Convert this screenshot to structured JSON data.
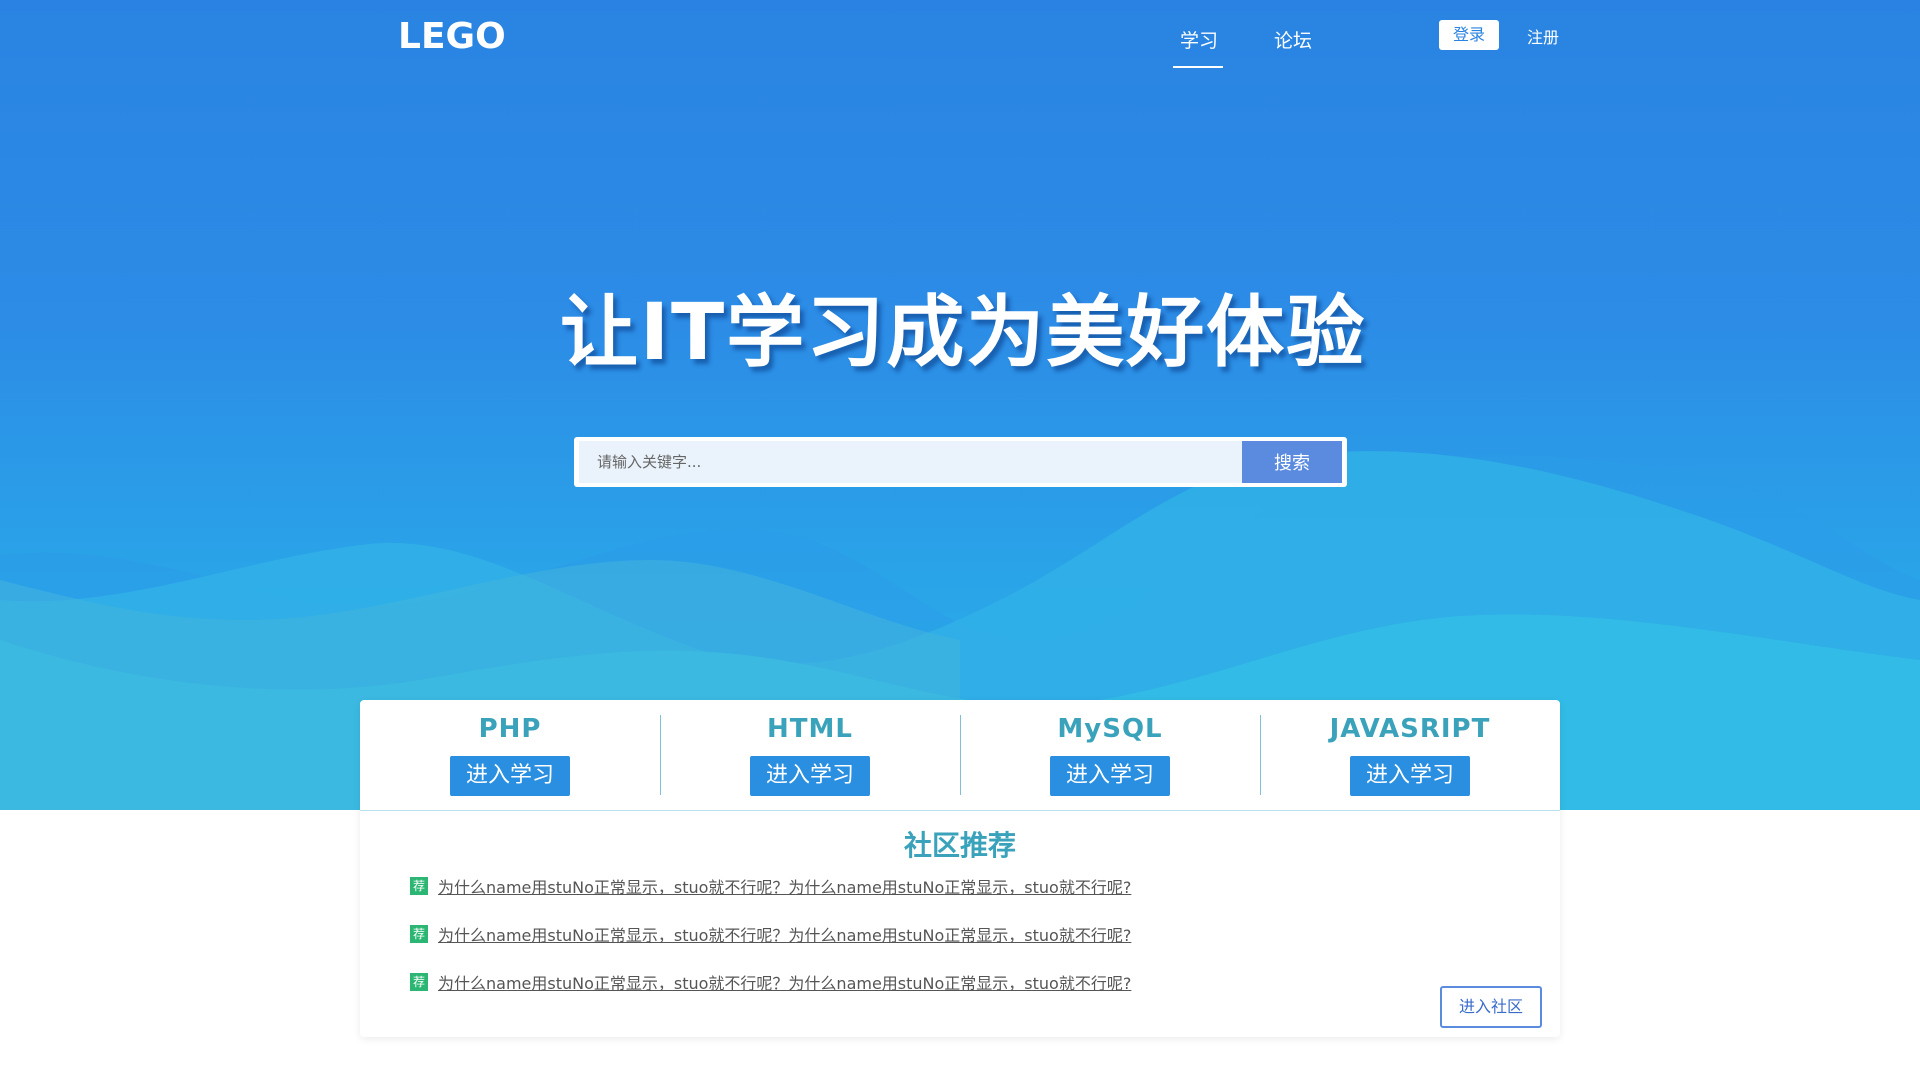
{
  "header": {
    "logo_text": "LEGO",
    "nav": [
      {
        "label": "学习",
        "active": true
      },
      {
        "label": "论坛",
        "active": false
      }
    ],
    "login_label": "登录",
    "register_label": "注册"
  },
  "hero": {
    "headline": "让IT学习成为美好体验",
    "search": {
      "placeholder": "请输入关键字...",
      "button_label": "搜索"
    }
  },
  "courses": [
    {
      "title": "PHP",
      "button_label": "进入学习"
    },
    {
      "title": "HTML",
      "button_label": "进入学习"
    },
    {
      "title": "MySQL",
      "button_label": "进入学习"
    },
    {
      "title": "JAVASRIPT",
      "button_label": "进入学习"
    }
  ],
  "community": {
    "title": "社区推荐",
    "badge_label": "荐",
    "posts": [
      "为什么name用stuNo正常显示，stuo就不行呢？为什么name用stuNo正常显示，stuo就不行呢?",
      "为什么name用stuNo正常显示，stuo就不行呢？为什么name用stuNo正常显示，stuo就不行呢?",
      "为什么name用stuNo正常显示，stuo就不行呢？为什么name用stuNo正常显示，stuo就不行呢?"
    ],
    "enter_label": "进入社区"
  },
  "colors": {
    "hero_top": "#2a83e2",
    "hero_bottom": "#2bb6ea",
    "accent": "#3aa2bb",
    "button_blue": "#2a8fe0",
    "search_button": "#5b8bdf",
    "badge_green": "#2bb673"
  }
}
